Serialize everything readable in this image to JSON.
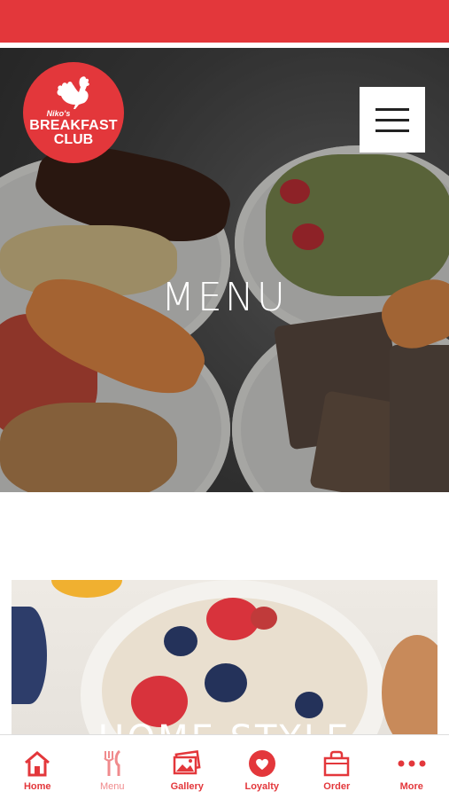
{
  "brand": {
    "prefix": "Niko's",
    "line1": "BREAKFAST",
    "line2": "CLUB",
    "color": "#e3373b"
  },
  "hero": {
    "title": "MENU"
  },
  "category_card": {
    "title": "HOME STYLE"
  },
  "tabs": [
    {
      "label": "Home",
      "icon": "home-icon"
    },
    {
      "label": "Menu",
      "icon": "fork-knife-icon"
    },
    {
      "label": "Gallery",
      "icon": "gallery-icon"
    },
    {
      "label": "Loyalty",
      "icon": "heart-icon"
    },
    {
      "label": "Order",
      "icon": "bag-icon"
    },
    {
      "label": "More",
      "icon": "more-dots-icon"
    }
  ],
  "active_tab": "Menu"
}
